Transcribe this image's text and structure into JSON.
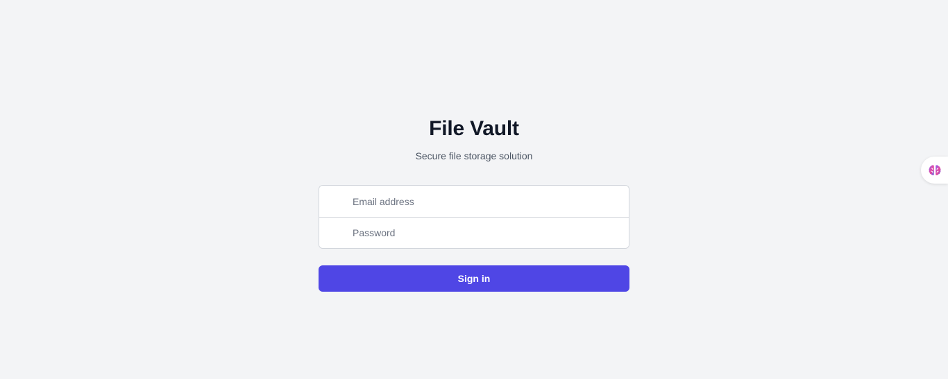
{
  "app": {
    "title": "File Vault",
    "subtitle": "Secure file storage solution"
  },
  "form": {
    "email_placeholder": "Email address",
    "email_value": "",
    "password_placeholder": "Password",
    "password_value": "",
    "submit_label": "Sign in"
  },
  "widget": {
    "icon": "brain-icon"
  },
  "colors": {
    "background": "#f3f4f6",
    "title": "#111827",
    "subtitle": "#4b5563",
    "primary": "#4f46e5",
    "border": "#d1d5db"
  }
}
